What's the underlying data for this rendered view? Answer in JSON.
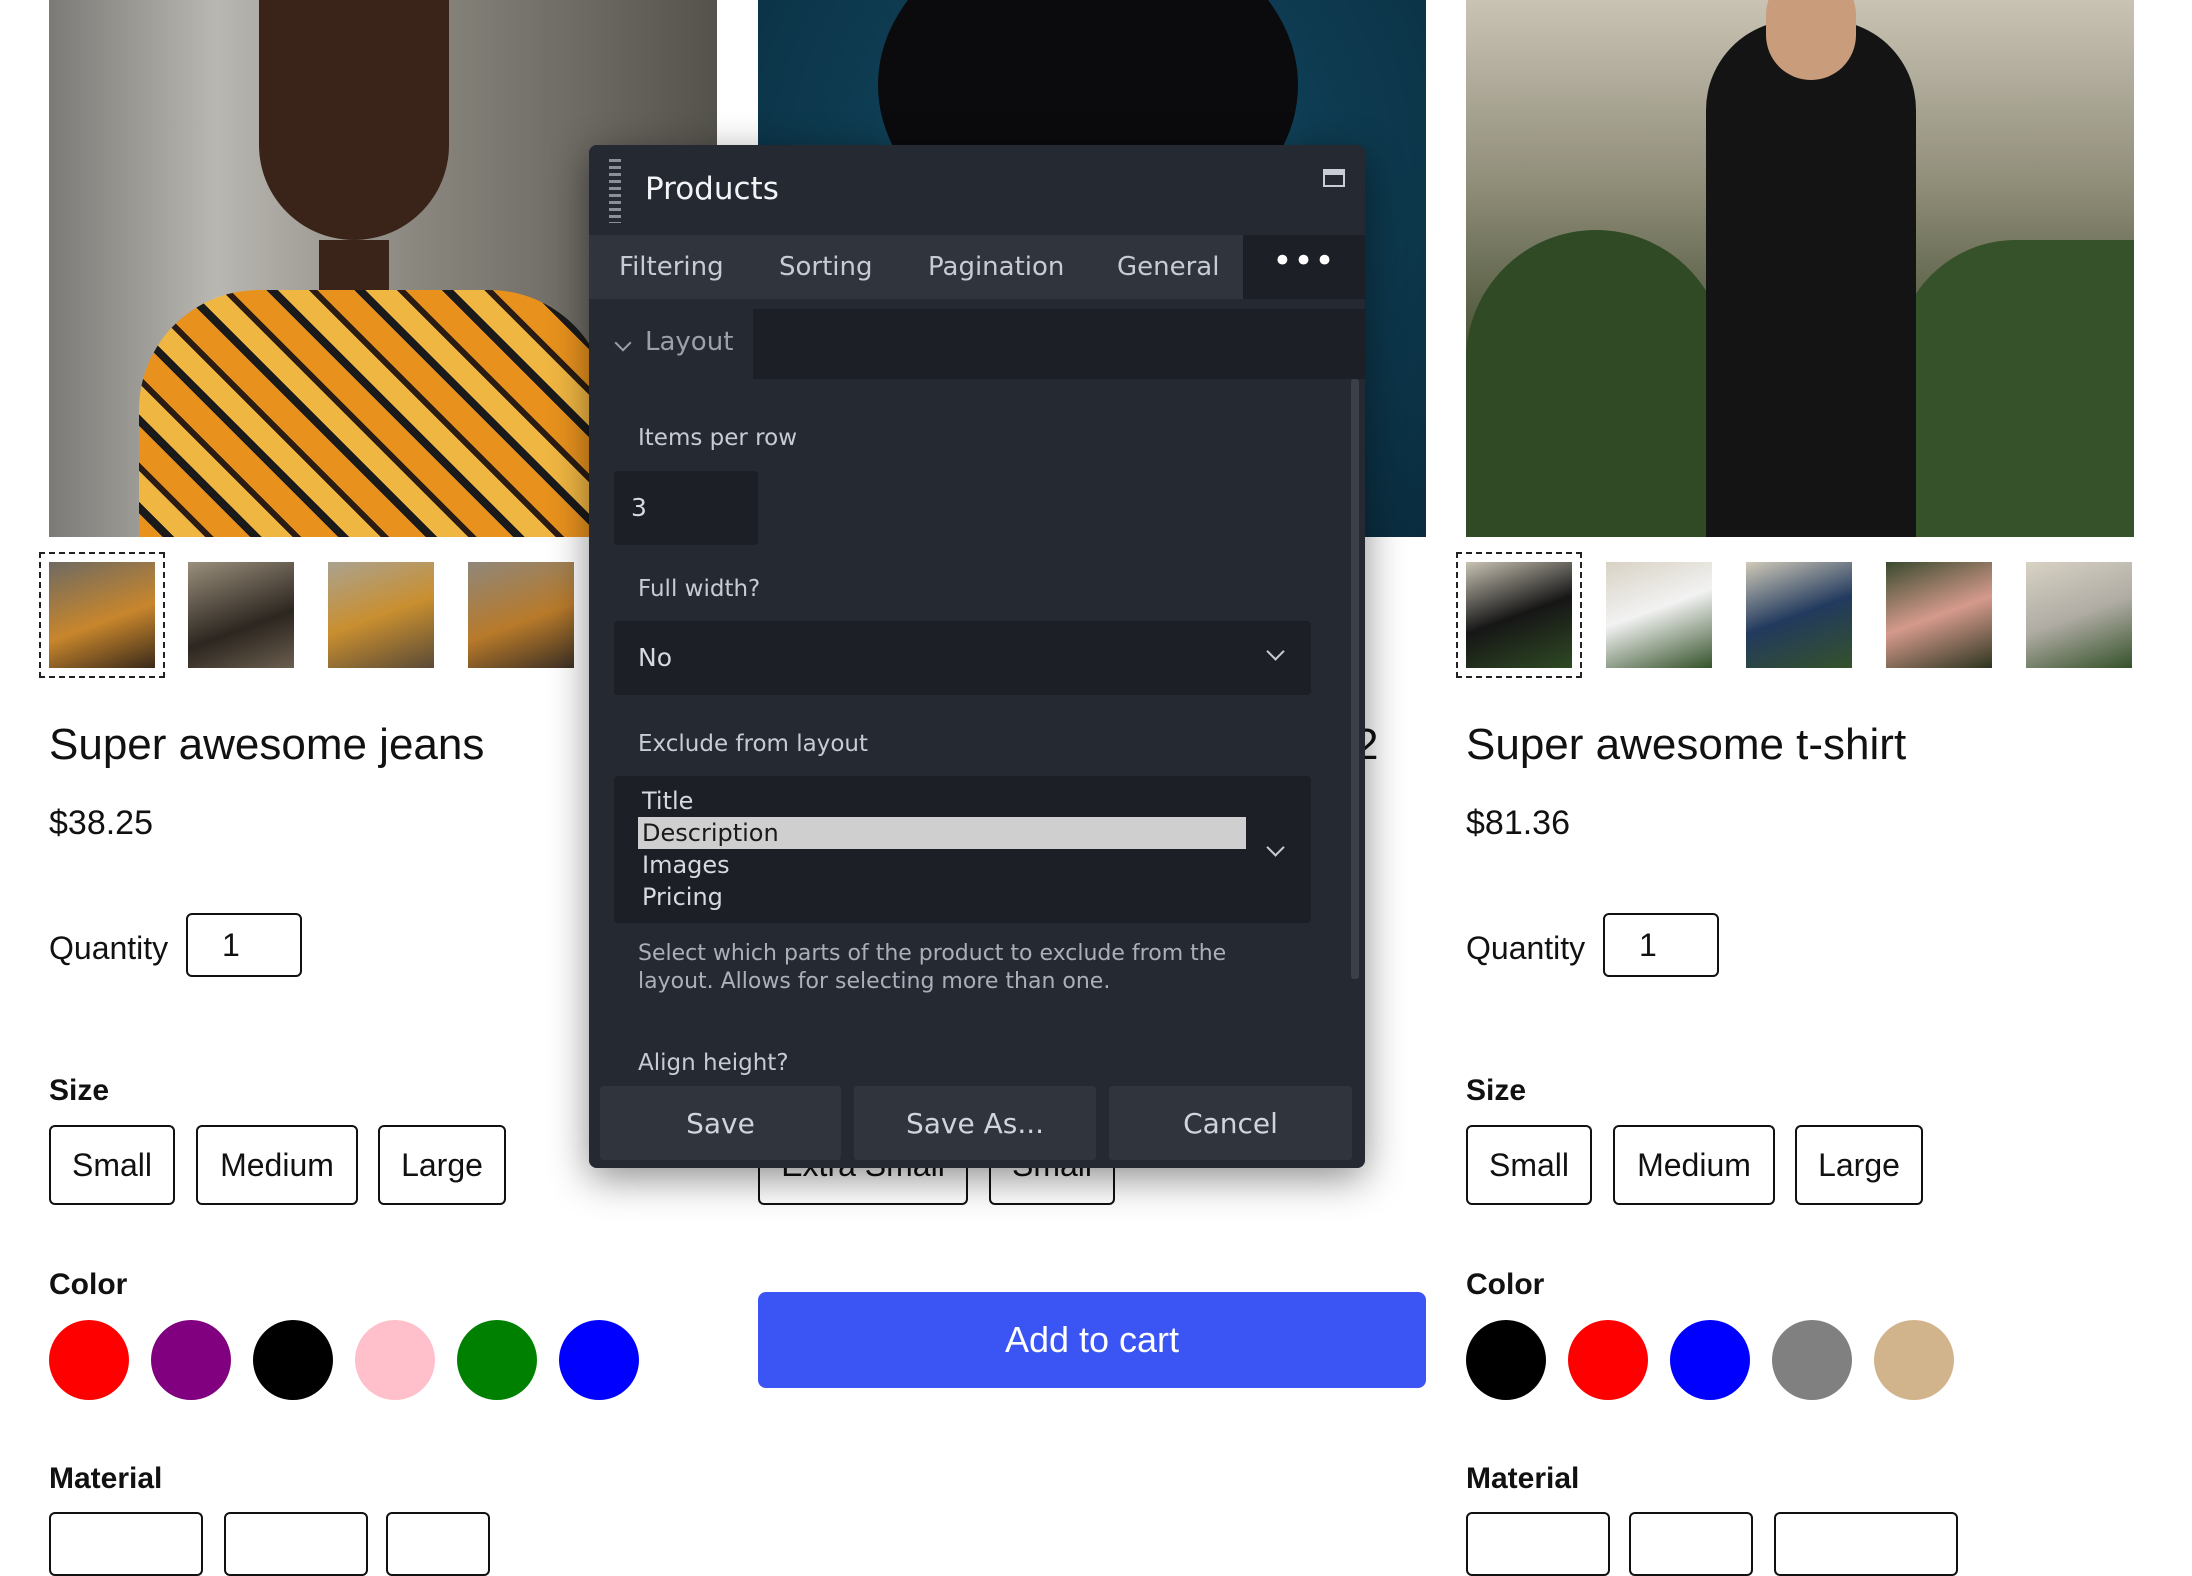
{
  "products": [
    {
      "title": "Super awesome jeans",
      "price": "$38.25",
      "quantity_label": "Quantity",
      "quantity_value": "1",
      "size_label": "Size",
      "sizes": [
        "Small",
        "Medium",
        "Large"
      ],
      "color_label": "Color",
      "colors": [
        "#ff0000",
        "#800080",
        "#000000",
        "#ffc0cb",
        "#008000",
        "#0000ff"
      ],
      "material_label": "Material"
    },
    {
      "title_fragment": "2",
      "sizes": [
        "Extra Small",
        "Small"
      ],
      "add_to_cart": "Add to cart"
    },
    {
      "title": "Super awesome t-shirt",
      "price": "$81.36",
      "quantity_label": "Quantity",
      "quantity_value": "1",
      "size_label": "Size",
      "sizes": [
        "Small",
        "Medium",
        "Large"
      ],
      "color_label": "Color",
      "colors": [
        "#000000",
        "#ff0000",
        "#0000ff",
        "#808080",
        "#d2b48c"
      ],
      "material_label": "Material"
    }
  ],
  "dialog": {
    "title": "Products",
    "tabs": [
      "Filtering",
      "Sorting",
      "Pagination",
      "General"
    ],
    "more_tab": "•••",
    "section": "Layout",
    "items_per_row_label": "Items per row",
    "items_per_row_value": "3",
    "full_width_label": "Full width?",
    "full_width_value": "No",
    "exclude_label": "Exclude from layout",
    "exclude_options": [
      "Title",
      "Description",
      "Images",
      "Pricing"
    ],
    "exclude_selected": "Description",
    "exclude_help": "Select which parts of the product to exclude from the layout. Allows for selecting more than one.",
    "align_height_label": "Align height?",
    "buttons": {
      "save": "Save",
      "save_as": "Save As...",
      "cancel": "Cancel"
    }
  }
}
